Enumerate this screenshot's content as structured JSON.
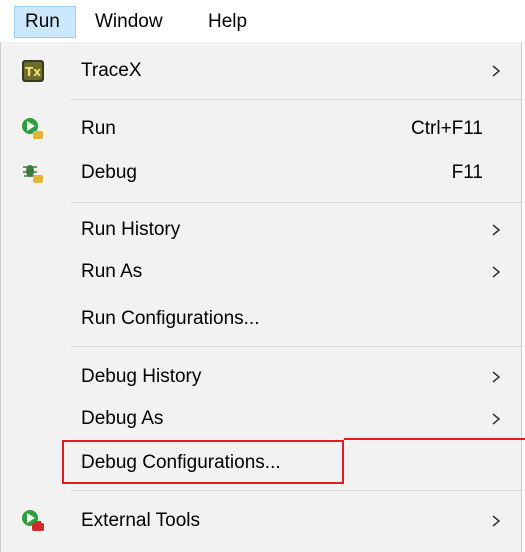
{
  "menubar": {
    "items": [
      {
        "label": "Run"
      },
      {
        "label": "Window"
      },
      {
        "label": "Help"
      }
    ]
  },
  "menu": {
    "items": [
      {
        "label": "TraceX",
        "shortcut": "",
        "icon": "tracex-icon",
        "submenu": true
      },
      {
        "label": "Run",
        "shortcut": "Ctrl+F11",
        "icon": "run-icon",
        "submenu": false
      },
      {
        "label": "Debug",
        "shortcut": "F11",
        "icon": "debug-icon",
        "submenu": false
      },
      {
        "label": "Run History",
        "shortcut": "",
        "submenu": true
      },
      {
        "label": "Run As",
        "shortcut": "",
        "submenu": true
      },
      {
        "label": "Run Configurations...",
        "shortcut": "",
        "submenu": false
      },
      {
        "label": "Debug History",
        "shortcut": "",
        "submenu": true
      },
      {
        "label": "Debug As",
        "shortcut": "",
        "submenu": true
      },
      {
        "label": "Debug Configurations...",
        "shortcut": "",
        "submenu": false
      },
      {
        "label": "External Tools",
        "shortcut": "",
        "icon": "external-tools-icon",
        "submenu": true
      }
    ]
  },
  "colors": {
    "menubar_active_bg": "#cce8ff",
    "menu_bg": "#f2f2f2",
    "highlight_border": "#e31b23"
  }
}
